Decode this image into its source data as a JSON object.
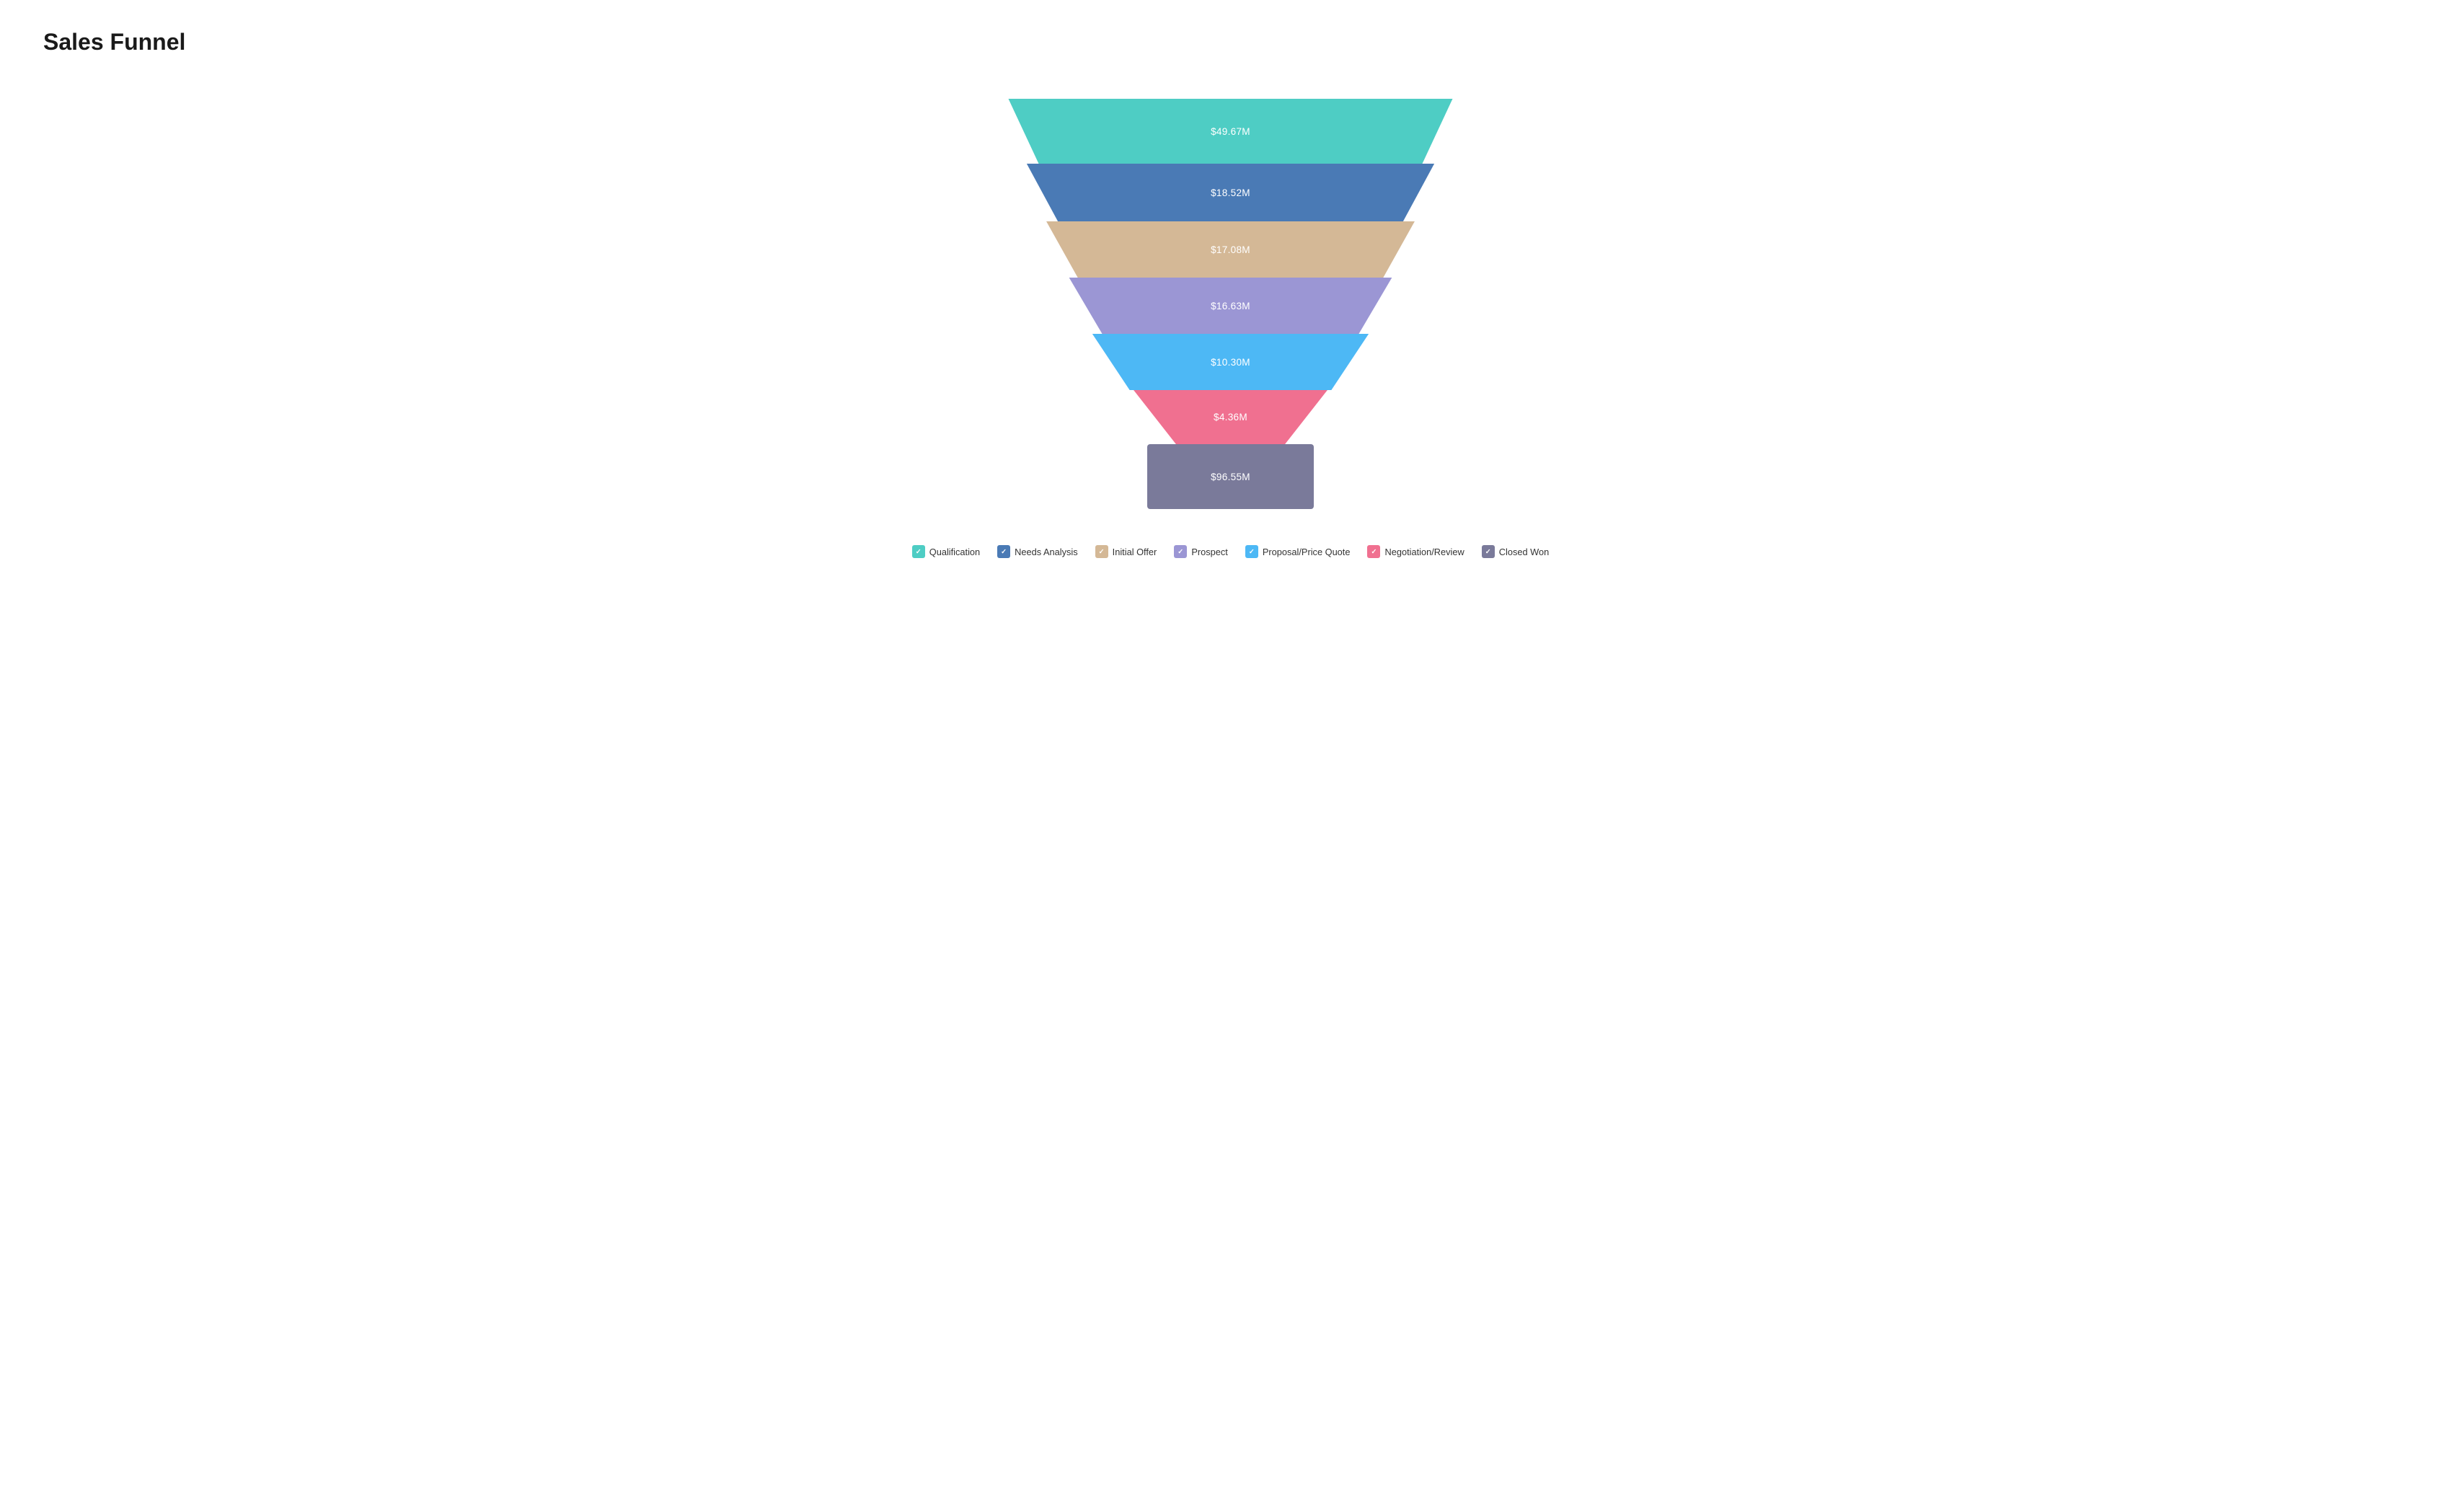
{
  "title": "Sales Funnel",
  "funnel": {
    "segments": [
      {
        "id": "qualification",
        "label": "$49.67M",
        "color": "#4ecdc4",
        "class": "seg-0"
      },
      {
        "id": "needs-analysis",
        "label": "$18.52M",
        "color": "#4a7ab5",
        "class": "seg-1"
      },
      {
        "id": "initial-offer",
        "label": "$17.08M",
        "color": "#d4b896",
        "class": "seg-2"
      },
      {
        "id": "prospect",
        "label": "$16.63M",
        "color": "#9b96d4",
        "class": "seg-3"
      },
      {
        "id": "proposal-price-quote",
        "label": "$10.30M",
        "color": "#4db8f5",
        "class": "seg-4"
      },
      {
        "id": "negotiation-review",
        "label": "$4.36M",
        "color": "#f07090",
        "class": "seg-5"
      },
      {
        "id": "closed-won",
        "label": "$96.55M",
        "color": "#7a7a9a",
        "class": "seg-6"
      }
    ]
  },
  "legend": {
    "items": [
      {
        "id": "qualification",
        "label": "Qualification",
        "color": "#4ecdc4"
      },
      {
        "id": "needs-analysis",
        "label": "Needs Analysis",
        "color": "#4a7ab5"
      },
      {
        "id": "initial-offer",
        "label": "Initial Offer",
        "color": "#d4b896"
      },
      {
        "id": "prospect",
        "label": "Prospect",
        "color": "#9b96d4"
      },
      {
        "id": "proposal-price-quote",
        "label": "Proposal/Price Quote",
        "color": "#4db8f5"
      },
      {
        "id": "negotiation-review",
        "label": "Negotiation/Review",
        "color": "#f07090"
      },
      {
        "id": "closed-won",
        "label": "Closed Won",
        "color": "#7a7a9a"
      }
    ]
  }
}
